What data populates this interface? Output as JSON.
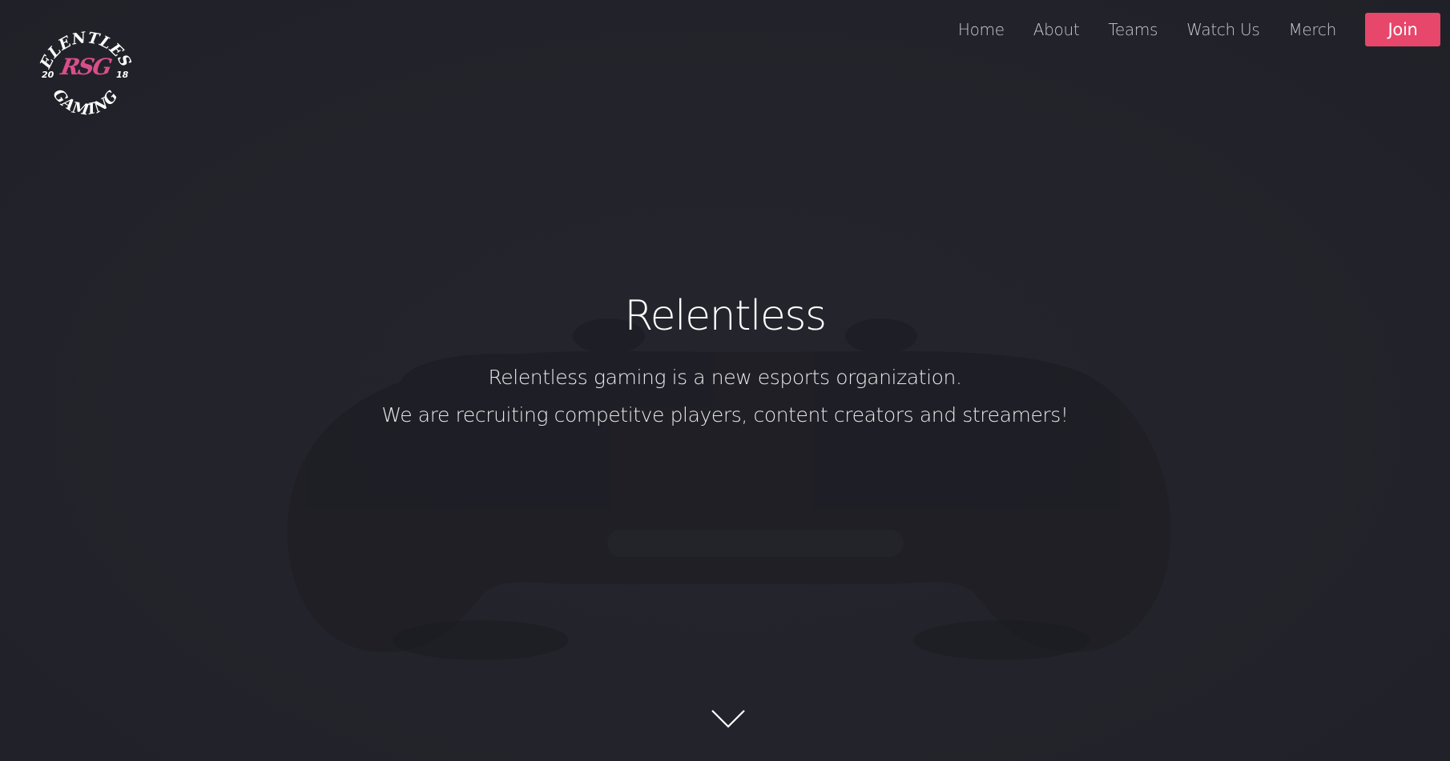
{
  "logo": {
    "top_text": "RELENTLESS",
    "bottom_text": "GAMING",
    "monogram": "RSG",
    "year_left": "20",
    "year_right": "18",
    "accent_color": "#d94e8a"
  },
  "nav": {
    "items": [
      {
        "label": "Home"
      },
      {
        "label": "About"
      },
      {
        "label": "Teams"
      },
      {
        "label": "Watch Us"
      },
      {
        "label": "Merch"
      }
    ],
    "join_label": "Join",
    "join_color": "#e6476a"
  },
  "hero": {
    "title": "Relentless",
    "line1": "Relentless gaming is a new esports organization.",
    "line2": "We are recruiting competitve players, content creators and streamers!",
    "background_icon": "gamepad-icon"
  },
  "scroll": {
    "icon": "chevron-down-icon"
  },
  "colors": {
    "background": "#24252c",
    "text": "#ffffff",
    "nav_text": "#c9cad0"
  }
}
